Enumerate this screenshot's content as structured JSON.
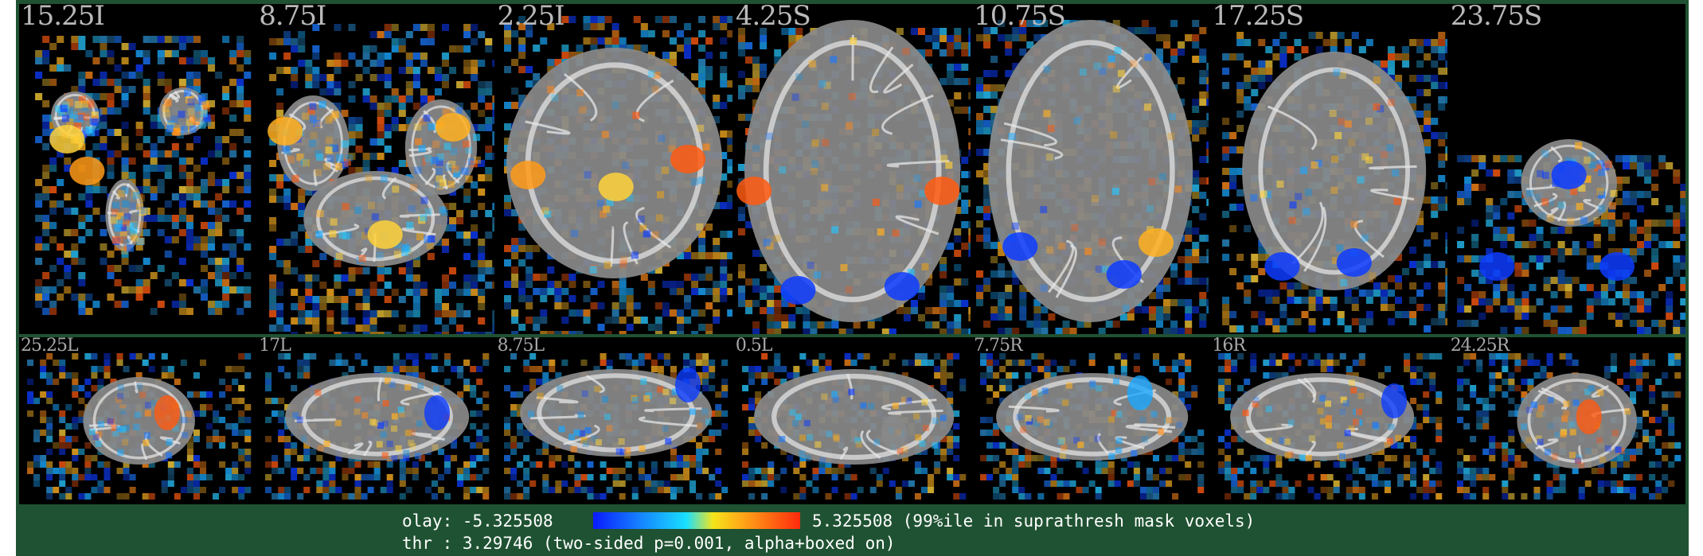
{
  "figure": {
    "axial_slices": [
      {
        "label": "15.25I"
      },
      {
        "label": "8.75I"
      },
      {
        "label": "2.25I"
      },
      {
        "label": "4.25S"
      },
      {
        "label": "10.75S"
      },
      {
        "label": "17.25S"
      },
      {
        "label": "23.75S"
      }
    ],
    "sagittal_slices": [
      {
        "label": "25.25L"
      },
      {
        "label": "17L"
      },
      {
        "label": "8.75L"
      },
      {
        "label": "0.5L"
      },
      {
        "label": "7.75R"
      },
      {
        "label": "16R"
      },
      {
        "label": "24.25R"
      }
    ],
    "legend": {
      "olay_label": "olay: -5.325508",
      "olay_max": "5.325508 (99%ile in suprathresh mask voxels)",
      "thr_text": "thr : 3.29746 (two-sided p=0.001, alpha+boxed on)",
      "colorbar_min": -5.325508,
      "colorbar_max": 5.325508,
      "colormap": [
        "#0a1bff",
        "#1580ff",
        "#19e0ff",
        "#f5e41a",
        "#ff9a17",
        "#ff2a0c"
      ]
    },
    "colors": {
      "frame": "#1f5232",
      "panel_bg": "#000000",
      "brain_tissue": "#8a8a8a",
      "white_matter": "#d8d8d8",
      "negative": "#1aa0ff",
      "positive": "#ffb020"
    }
  }
}
